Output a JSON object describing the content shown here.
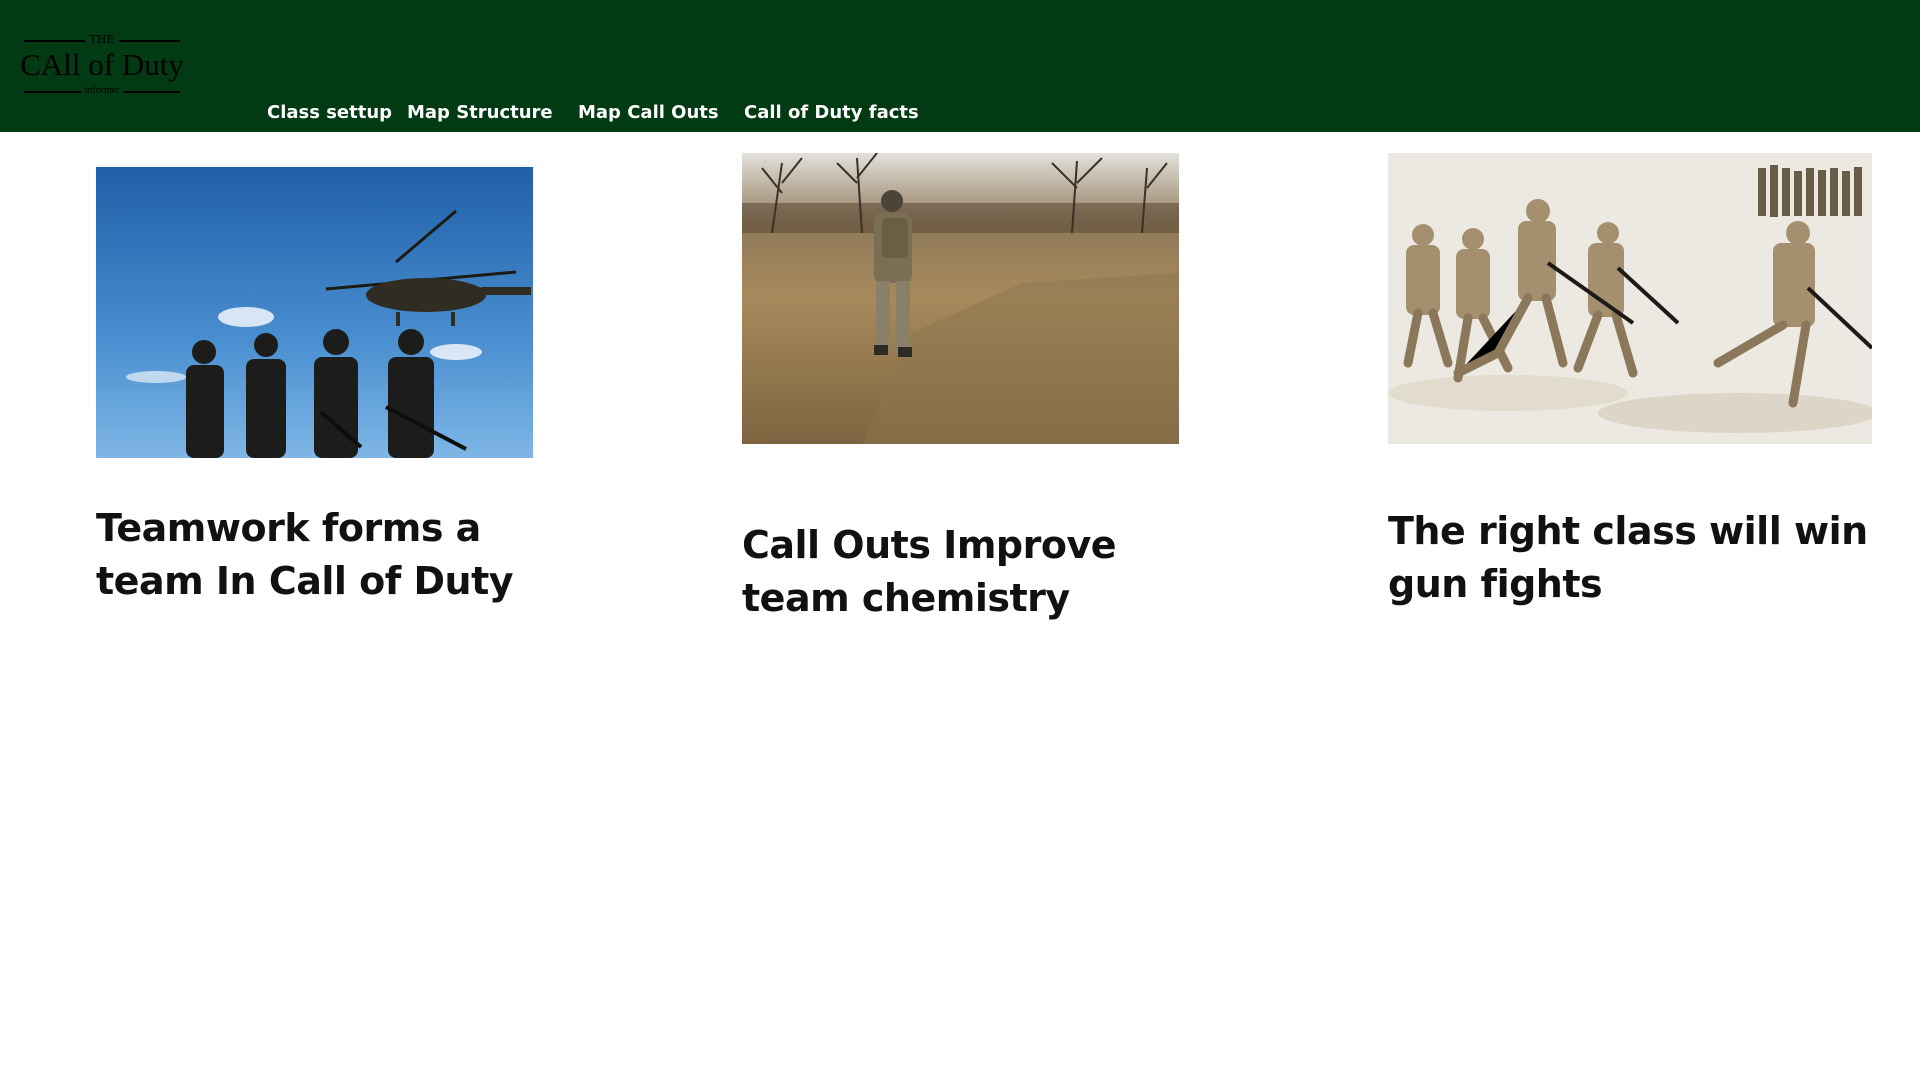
{
  "logo": {
    "the": "THE",
    "title": "CAll of Duty",
    "subtitle": "informer"
  },
  "nav": {
    "items": [
      {
        "label": "Class settup"
      },
      {
        "label": "Map Structure"
      },
      {
        "label": "Map Call Outs"
      },
      {
        "label": "Call of Duty facts"
      }
    ]
  },
  "colors": {
    "header_bg": "#013a13",
    "nav_text": "#ffffff",
    "title_text": "#111111"
  },
  "cards": [
    {
      "image": "soldiers-helicopter-photo",
      "title": "Teamwork forms a team In Call of Duty"
    },
    {
      "image": "soldier-walking-field-photo",
      "title": "Call Outs Improve team chemistry"
    },
    {
      "image": "soldiers-running-sand-photo",
      "title": "The right class will win gun fights"
    }
  ]
}
